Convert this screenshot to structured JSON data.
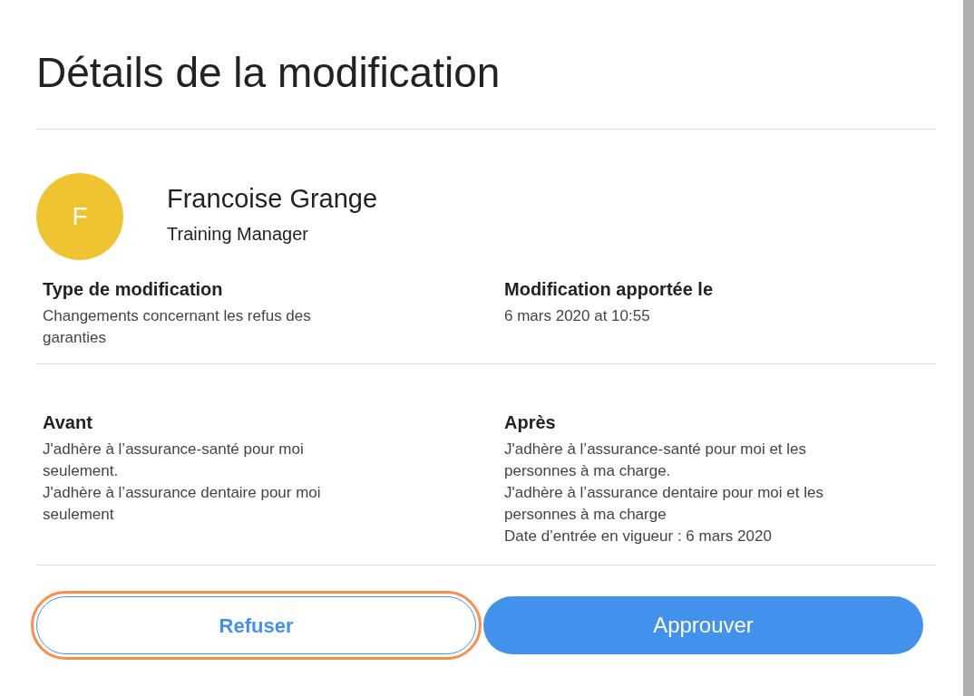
{
  "dialog": {
    "title": "Détails de la modification"
  },
  "employee": {
    "initial": "F",
    "name": "Francoise Grange",
    "role": "Training Manager"
  },
  "info": [
    {
      "label": "Type de modification",
      "lines": [
        "Changements concernant les refus des garanties"
      ]
    },
    {
      "label": "Modification apportée le",
      "lines": [
        "6 mars 2020 at 10:55"
      ]
    }
  ],
  "comparison": [
    {
      "label": "Avant",
      "lines": [
        "J'adhère à l’assurance-santé pour moi seulement.",
        "J'adhère à l’assurance dentaire pour moi seulement"
      ]
    },
    {
      "label": "Après",
      "lines": [
        "J'adhère à l’assurance-santé pour moi et les personnes à ma charge.",
        "J'adhère à l’assurance dentaire pour moi et les personnes à ma charge",
        "Date d’entrée en vigueur : 6 mars 2020"
      ]
    }
  ],
  "buttons": [
    {
      "label": "Refuser",
      "kind": "secondary",
      "focused": true
    },
    {
      "label": "Approuver",
      "kind": "primary",
      "focused": false
    }
  ]
}
